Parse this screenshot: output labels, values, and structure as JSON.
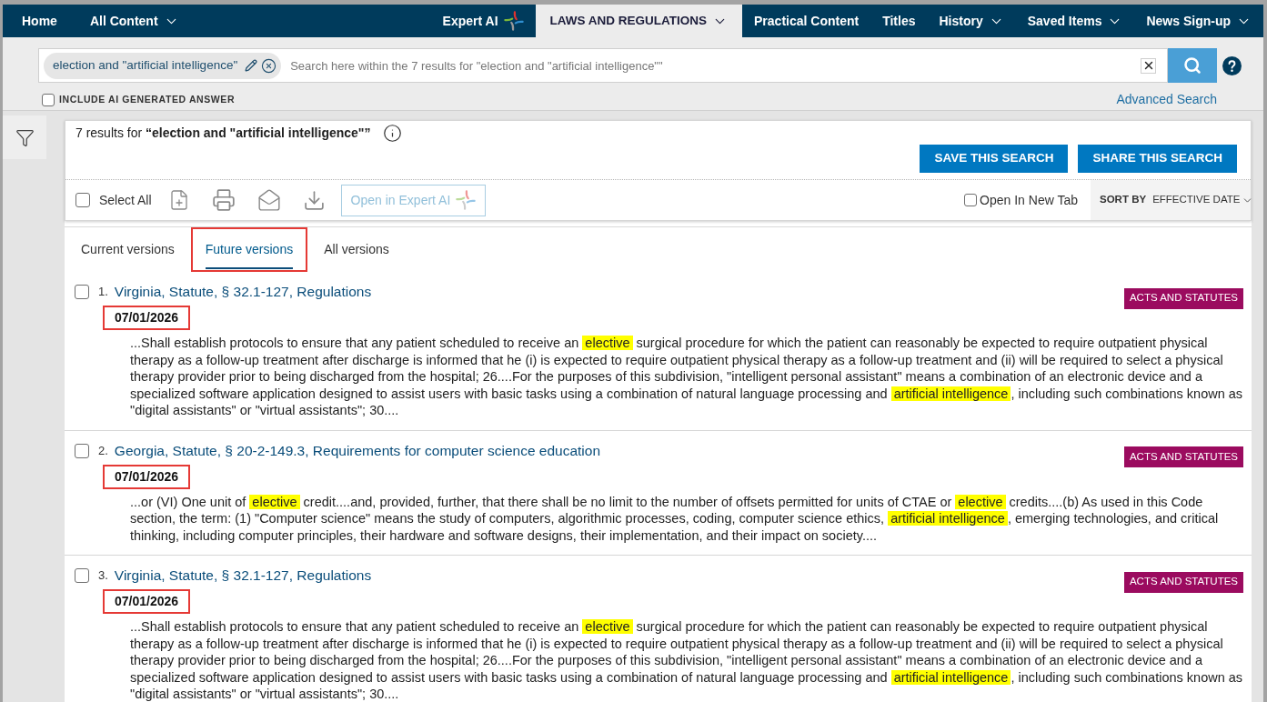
{
  "nav": {
    "left": [
      {
        "label": "Home",
        "kind": "link",
        "selected": false
      },
      {
        "label": "All Content",
        "kind": "dropdown",
        "selected": false
      }
    ],
    "right": [
      {
        "label": "Expert AI",
        "kind": "ai",
        "selected": false
      },
      {
        "label": "LAWS AND REGULATIONS",
        "kind": "dropdown",
        "selected": true
      },
      {
        "label": "Practical Content",
        "kind": "link",
        "selected": false
      },
      {
        "label": "Titles",
        "kind": "link",
        "selected": false
      },
      {
        "label": "History",
        "kind": "dropdown",
        "selected": false
      },
      {
        "label": "Saved Items",
        "kind": "dropdown",
        "selected": false
      },
      {
        "label": "News Sign-up",
        "kind": "dropdown",
        "selected": false
      }
    ]
  },
  "search": {
    "query": "election and \"artificial intelligence\"",
    "placeholder": "Search here within the 7 results for \"election and \"artificial intelligence\"\"",
    "include_ai_answer": {
      "label": "INCLUDE AI GENERATED ANSWER",
      "checked": false
    },
    "advanced_search": "Advanced Search"
  },
  "results_header": {
    "summary": "7 results for **“election and \"artificial intelligence\"”**",
    "buttons": [
      "SAVE THIS SEARCH",
      "SHARE THIS SEARCH"
    ]
  },
  "toolbar": {
    "select_all": {
      "label": "Select All",
      "checked": false
    },
    "open_in_expert_ai": {
      "label": "Open in Expert AI",
      "disabled": true
    },
    "open_in_new_tab": {
      "label": "Open In New Tab",
      "checked": false
    },
    "sort": {
      "label": "SORT BY",
      "value": "EFFECTIVE DATE"
    }
  },
  "version_tabs": [
    {
      "label": "Current versions",
      "selected": false,
      "outlined": false
    },
    {
      "label": "Future versions",
      "selected": true,
      "outlined": true
    },
    {
      "label": "All versions",
      "selected": false,
      "outlined": false
    }
  ],
  "results": [
    {
      "number": "1.",
      "title": "Virginia, Statute, § 32.1-127, Regulations",
      "badge": "ACTS AND STATUTES",
      "date": "07/01/2026",
      "date_outlined": true,
      "checked": false,
      "snippet": [
        {
          "text": "...Shall establish protocols to ensure that any patient scheduled to receive an ",
          "highlighted": false
        },
        {
          "text": "elective",
          "highlighted": true
        },
        {
          "text": " surgical procedure for which the patient can reasonably be expected to require outpatient physical therapy as a follow-up treatment after discharge is informed that he (i) is expected to require outpatient physical therapy as a follow-up treatment and (ii) will be required to select a physical therapy provider prior to being discharged from the hospital; 26....For the purposes of this subdivision, \"intelligent personal assistant\" means a combination of an electronic device and a specialized software application designed to assist users with basic tasks using a combination of natural language processing and ",
          "highlighted": false
        },
        {
          "text": "artificial intelligence",
          "highlighted": true
        },
        {
          "text": ", including such combinations known as \"digital assistants\" or \"virtual assistants\"; 30....",
          "highlighted": false
        }
      ]
    },
    {
      "number": "2.",
      "title": "Georgia, Statute, § 20-2-149.3, Requirements for computer science education",
      "badge": "ACTS AND STATUTES",
      "date": "07/01/2026",
      "date_outlined": true,
      "checked": false,
      "snippet": [
        {
          "text": "...or (VI) One unit of ",
          "highlighted": false
        },
        {
          "text": "elective",
          "highlighted": true
        },
        {
          "text": " credit....and, provided, further, that there shall be no limit to the number of offsets permitted for units of CTAE or ",
          "highlighted": false
        },
        {
          "text": "elective",
          "highlighted": true
        },
        {
          "text": " credits....(b) As used in this Code section, the term: (1) \"Computer science\" means the study of computers, algorithmic processes, coding, computer science ethics, ",
          "highlighted": false
        },
        {
          "text": "artificial intelligence",
          "highlighted": true
        },
        {
          "text": ", emerging technologies, and critical thinking, including computer principles, their hardware and software designs, their implementation, and their impact on society....",
          "highlighted": false
        }
      ]
    },
    {
      "number": "3.",
      "title": "Virginia, Statute, § 32.1-127, Regulations",
      "badge": "ACTS AND STATUTES",
      "date": "07/01/2026",
      "date_outlined": true,
      "checked": false,
      "snippet": [
        {
          "text": "...Shall establish protocols to ensure that any patient scheduled to receive an ",
          "highlighted": false
        },
        {
          "text": "elective",
          "highlighted": true
        },
        {
          "text": " surgical procedure for which the patient can reasonably be expected to require outpatient physical therapy as a follow-up treatment after discharge is informed that he (i) is expected to require outpatient physical therapy as a follow-up treatment and (ii) will be required to select a physical therapy provider prior to being discharged from the hospital; 26....For the purposes of this subdivision, \"intelligent personal assistant\" means a combination of an electronic device and a specialized software application designed to assist users with basic tasks using a combination of natural language processing and ",
          "highlighted": false
        },
        {
          "text": "artificial intelligence",
          "highlighted": true
        },
        {
          "text": ", including such combinations known as \"digital assistants\" or \"virtual assistants\"; 30....",
          "highlighted": false
        }
      ]
    }
  ]
}
